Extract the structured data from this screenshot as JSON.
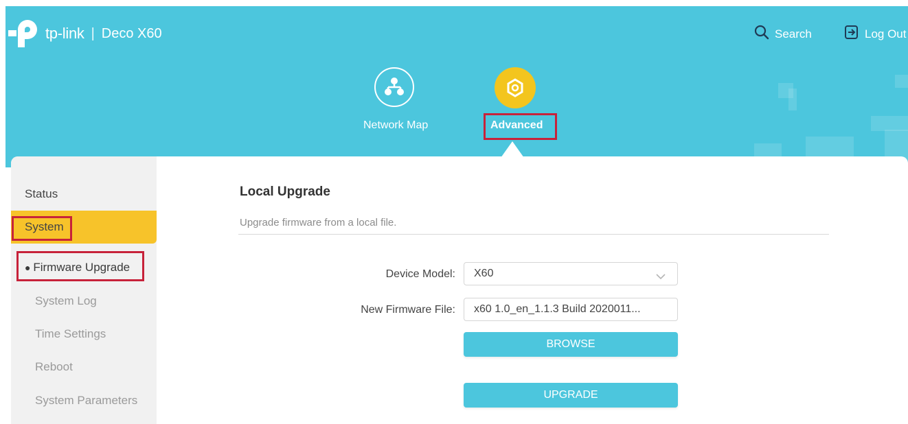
{
  "brand": {
    "logo_text": "tp-link",
    "separator": "|",
    "model": "Deco X60"
  },
  "header": {
    "search_label": "Search",
    "logout_label": "Log Out"
  },
  "topnav": {
    "network_map_label": "Network Map",
    "advanced_label": "Advanced",
    "active": "Advanced"
  },
  "sidebar": {
    "status_label": "Status",
    "system_label": "System",
    "items": [
      {
        "label": "Firmware Upgrade",
        "active": true
      },
      {
        "label": "System Log",
        "active": false
      },
      {
        "label": "Time Settings",
        "active": false
      },
      {
        "label": "Reboot",
        "active": false
      },
      {
        "label": "System Parameters",
        "active": false
      }
    ]
  },
  "main": {
    "title": "Local Upgrade",
    "description": "Upgrade firmware from a local file.",
    "device_model_label": "Device Model:",
    "device_model_value": "X60",
    "firmware_file_label": "New Firmware File:",
    "firmware_file_value": "x60 1.0_en_1.1.3 Build 2020011...",
    "browse_label": "BROWSE",
    "upgrade_label": "UPGRADE"
  },
  "colors": {
    "header_bg": "#4cc6dd",
    "accent_yellow": "#f7c32a",
    "highlight_red": "#c7223a",
    "button": "#4cc6dd"
  },
  "icons": [
    "tp-link-logo-icon",
    "search-icon",
    "logout-icon",
    "network-map-icon",
    "advanced-gear-icon",
    "chevron-down-icon"
  ]
}
